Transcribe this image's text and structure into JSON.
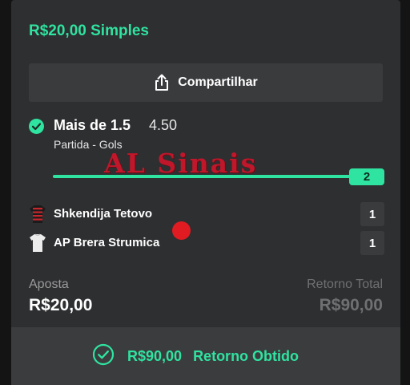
{
  "bet": {
    "title": "R$20,00 Simples",
    "share_label": "Compartilhar"
  },
  "selection": {
    "market": "Mais de 1.5",
    "odds": "4.50",
    "subtitle": "Partida - Gols",
    "progress_value": "2",
    "progress_fraction": 1.0
  },
  "watermark": "AL Sinais",
  "teams": [
    {
      "name": "Shkendija Tetovo",
      "score": "1"
    },
    {
      "name": "AP Brera Strumica",
      "score": "1"
    }
  ],
  "summary": {
    "stake_label": "Aposta",
    "stake_value": "R$20,00",
    "return_label": "Retorno Total",
    "return_value": "R$90,00"
  },
  "result": {
    "amount": "R$90,00",
    "text": "Retorno Obtido"
  },
  "colors": {
    "accent": "#2fe3a0",
    "card": "#2e2f31",
    "watermark": "#c0172b"
  },
  "icons": [
    "share-icon",
    "check-circle-icon",
    "jersey-icon"
  ]
}
